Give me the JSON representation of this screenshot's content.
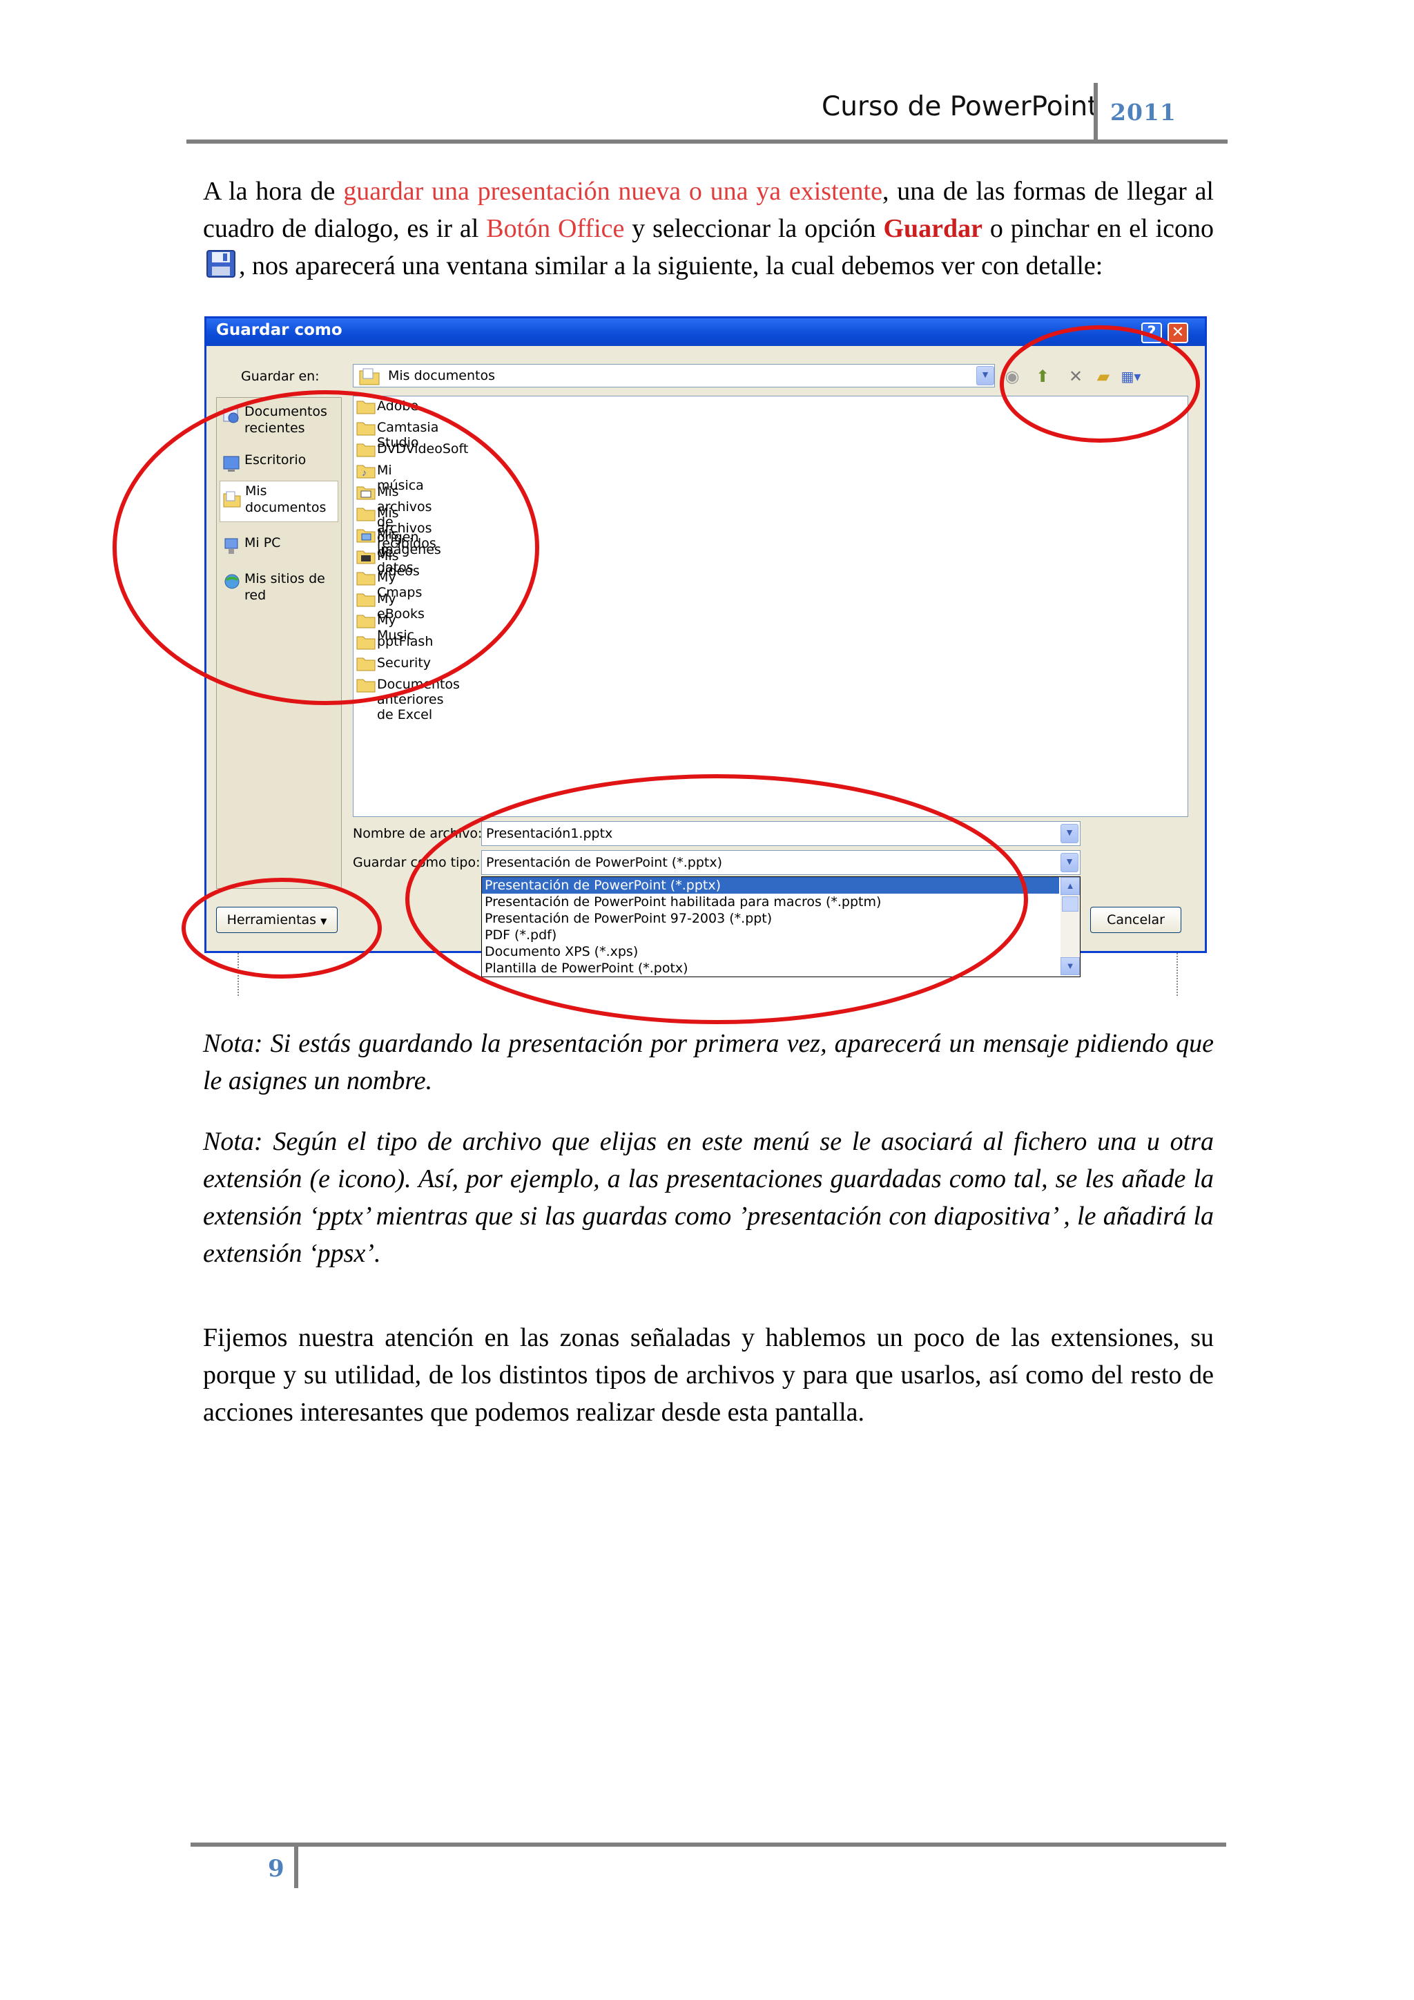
{
  "header": {
    "title": "Curso de PowerPoint",
    "year": "2011"
  },
  "intro": {
    "t1": "A la hora de ",
    "link1": "guardar una presentación nueva o una ya existente",
    "t2": ", una de las formas de llegar al cuadro de dialogo, es ir al ",
    "link2": "Botón Office",
    "t3": " y seleccionar la opción ",
    "bold": "Guardar",
    "t4": " o pinchar en el icono",
    "t5": ", nos aparecerá una ventana similar a la siguiente, la cual debemos ver con detalle:"
  },
  "dialog": {
    "title": "Guardar como",
    "help": "?",
    "close": "✕",
    "save_in_label": "Guardar en:",
    "save_in_value": "Mis documentos",
    "places": [
      {
        "label": "Documentos recientes",
        "icon": "recent-documents-icon"
      },
      {
        "label": "Escritorio",
        "icon": "desktop-icon"
      },
      {
        "label": "Mis documentos",
        "icon": "my-documents-icon"
      },
      {
        "label": "Mi PC",
        "icon": "my-computer-icon"
      },
      {
        "label": "Mis sitios de red",
        "icon": "network-places-icon"
      }
    ],
    "files": [
      "Adobe",
      "Camtasia Studio",
      "DVDVideoSoft",
      "Mi música",
      "Mis archivos de origen de datos",
      "Mis archivos recibidos",
      "Mis imágenes",
      "Mis vídeos",
      "My Cmaps",
      "My eBooks",
      "My Music",
      "pptFlash",
      "Security",
      "Documentos anteriores de Excel"
    ],
    "filename_label": "Nombre de archivo:",
    "filename_value": "Presentación1.pptx",
    "filetype_label": "Guardar como tipo:",
    "filetype_value": "Presentación de PowerPoint (*.pptx)",
    "filetype_options": [
      "Presentación de PowerPoint (*.pptx)",
      "Presentación de PowerPoint habilitada para macros (*.pptm)",
      "Presentación de PowerPoint 97-2003 (*.ppt)",
      "PDF (*.pdf)",
      "Documento XPS (*.xps)",
      "Plantilla de PowerPoint (*.potx)"
    ],
    "tools_button": "Herramientas",
    "cancel_button": "Cancelar"
  },
  "notes": [
    "Nota: Si estás guardando la presentación por primera vez, aparecerá un mensaje pidiendo que le asignes un nombre.",
    "Nota: Según el tipo de archivo que elijas en este menú se le asociará al fichero una u otra extensión (e icono). Así, por ejemplo, a las presentaciones guardadas como tal, se les añade la extensión ‘pptx’ mientras que si las guardas como ’presentación con diapositiva’ , le añadirá la extensión  ‘ppsx’."
  ],
  "closing": "Fijemos nuestra atención en las zonas señaladas y hablemos un poco de  las extensiones, su porque y su  utilidad,  de los distintos tipos de archivos y para que usarlos, así  como  del resto de acciones interesantes que podemos realizar desde esta pantalla.",
  "footer": {
    "page_number": "9"
  },
  "colors": {
    "accent_red": "#e03c3c",
    "header_blue": "#4f81bd",
    "xp_title": "#0b4bd6",
    "selection": "#316ac5"
  }
}
